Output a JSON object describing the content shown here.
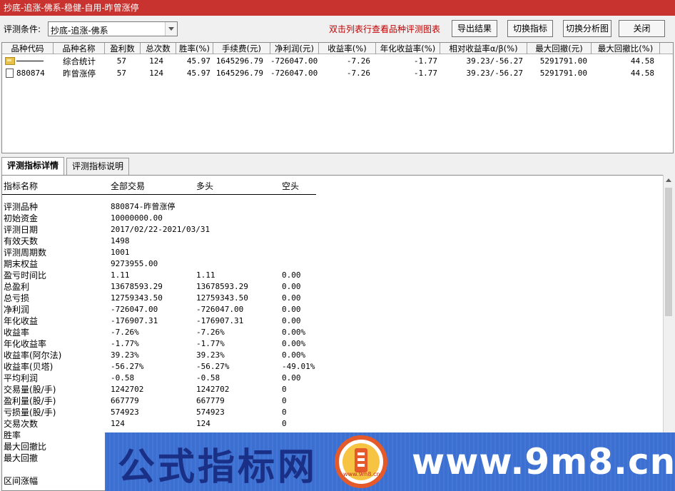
{
  "window": {
    "title": "抄底-追涨-佛系-稳健-自用-昨曾涨停"
  },
  "toolbar": {
    "cond_label": "评测条件:",
    "cond_value": "抄底-追涨-佛系",
    "hint": "双击列表行查看品种评测图表",
    "export_label": "导出结果",
    "switch_indicator_label": "切换指标",
    "switch_chart_label": "切换分析图",
    "close_label": "关闭"
  },
  "grid": {
    "columns": [
      "品种代码",
      "品种名称",
      "盈利数",
      "总次数",
      "胜率(%)",
      "手续费(元)",
      "净利润(元)",
      "收益率(%)",
      "年化收益率(%)",
      "相对收益率α/β(%)",
      "最大回撤(元)",
      "最大回撤比(%)"
    ],
    "rows": [
      {
        "icon": "folder-icon",
        "code": "",
        "name": "综合统计",
        "wins": "57",
        "total": "124",
        "winrate": "45.97",
        "fee": "1645296.79",
        "net": "-726047.00",
        "ret": "-7.26",
        "annual": "-1.77",
        "relative": "39.23/-56.27",
        "maxdd": "5291791.00",
        "maxddr": "44.58"
      },
      {
        "icon": "document-icon",
        "code": "880874",
        "name": "昨曾涨停",
        "wins": "57",
        "total": "124",
        "winrate": "45.97",
        "fee": "1645296.79",
        "net": "-726047.00",
        "ret": "-7.26",
        "annual": "-1.77",
        "relative": "39.23/-56.27",
        "maxdd": "5291791.00",
        "maxddr": "44.58"
      }
    ]
  },
  "tabs": [
    {
      "label": "评测指标详情"
    },
    {
      "label": "评测指标说明"
    }
  ],
  "detail": {
    "headers": {
      "name": "指标名称",
      "all": "全部交易",
      "long": "多头",
      "short": "空头"
    },
    "rows": [
      {
        "label": "评测品种",
        "all": "880874-昨曾涨停",
        "long": "",
        "short": ""
      },
      {
        "label": "初始资金",
        "all": "10000000.00",
        "long": "",
        "short": ""
      },
      {
        "label": "评测日期",
        "all": "2017/02/22-2021/03/31",
        "long": "",
        "short": ""
      },
      {
        "label": "有效天数",
        "all": "1498",
        "long": "",
        "short": ""
      },
      {
        "label": "评测周期数",
        "all": "1001",
        "long": "",
        "short": ""
      },
      {
        "label": "期末权益",
        "all": "9273955.00",
        "long": "",
        "short": ""
      },
      {
        "label": "盈亏时间比",
        "all": "1.11",
        "long": "1.11",
        "short": "0.00"
      },
      {
        "label": "总盈利",
        "all": "13678593.29",
        "long": "13678593.29",
        "short": "0.00"
      },
      {
        "label": "总亏损",
        "all": "12759343.50",
        "long": "12759343.50",
        "short": "0.00"
      },
      {
        "label": "净利润",
        "all": "-726047.00",
        "long": "-726047.00",
        "short": "0.00"
      },
      {
        "label": "年化收益",
        "all": "-176907.31",
        "long": "-176907.31",
        "short": "0.00"
      },
      {
        "label": "收益率",
        "all": "-7.26%",
        "long": "-7.26%",
        "short": "0.00%"
      },
      {
        "label": "年化收益率",
        "all": "-1.77%",
        "long": "-1.77%",
        "short": "0.00%"
      },
      {
        "label": "收益率(阿尔法)",
        "all": "39.23%",
        "long": "39.23%",
        "short": "0.00%"
      },
      {
        "label": "收益率(贝塔)",
        "all": "-56.27%",
        "long": "-56.27%",
        "short": "-49.01%"
      },
      {
        "label": "平均利润",
        "all": "-0.58",
        "long": "-0.58",
        "short": "0.00"
      },
      {
        "label": "交易量(股/手)",
        "all": "1242702",
        "long": "1242702",
        "short": "0"
      },
      {
        "label": "盈利量(股/手)",
        "all": "667779",
        "long": "667779",
        "short": "0"
      },
      {
        "label": "亏损量(股/手)",
        "all": "574923",
        "long": "574923",
        "short": "0"
      },
      {
        "label": "交易次数",
        "all": "124",
        "long": "124",
        "short": "0"
      },
      {
        "label": "胜率",
        "all": "",
        "long": "",
        "short": ""
      },
      {
        "label": "最大回撤比",
        "all": "",
        "long": "",
        "short": ""
      },
      {
        "label": "最大回撤",
        "all": "",
        "long": "",
        "short": ""
      },
      {
        "label": "",
        "all": "",
        "long": "",
        "short": ""
      },
      {
        "label": "区间涨幅",
        "all": "",
        "long": "",
        "short": ""
      }
    ]
  },
  "watermark": {
    "brand": "公式指标网",
    "url": "www.9m8.cn",
    "logo_sub": "www.9m8.cn"
  },
  "colors": {
    "title_bar": "#c8322f",
    "hint_red": "#c00000",
    "banner_blue": "#3b6fd1",
    "brand_navy": "#1a2f86"
  }
}
